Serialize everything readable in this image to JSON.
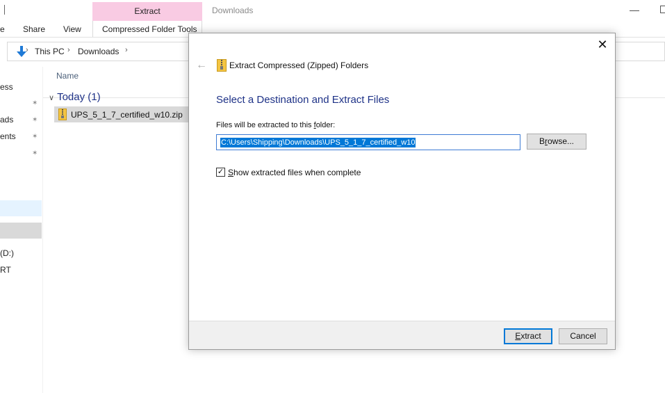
{
  "window": {
    "title": "Downloads",
    "minimize_glyph": "—"
  },
  "ribbon": {
    "context_tab_label": "Extract",
    "tabs": [
      "e",
      "Share",
      "View",
      "Compressed Folder Tools"
    ]
  },
  "address": {
    "crumbs": [
      "This PC",
      "Downloads"
    ],
    "separator": "›"
  },
  "nav_pane": {
    "items": [
      "ess",
      "ads",
      "ents",
      "(D:)",
      "RT"
    ],
    "pin_glyph": "✶"
  },
  "file_list": {
    "column_name": "Name",
    "group_label": "Today (1)",
    "group_chevron": "∨",
    "files": [
      {
        "name": "UPS_5_1_7_certified_w10.zip",
        "icon": "zip-folder-icon"
      }
    ]
  },
  "dialog": {
    "back_glyph": "←",
    "close_glyph": "✕",
    "title": "Extract Compressed (Zipped) Folders",
    "heading": "Select a Destination and Extract Files",
    "label_pre": "Files will be extracted to this ",
    "label_mnemonic": "f",
    "label_post": "older:",
    "path_value": "C:\\Users\\Shipping\\Downloads\\UPS_5_1_7_certified_w10",
    "browse_mnemonic": "r",
    "browse_pre": "B",
    "browse_post": "owse...",
    "checkbox_checked": true,
    "checkbox_mark": "✓",
    "checkbox_mnemonic": "S",
    "checkbox_label_rest": "how extracted files when complete",
    "extract_mnemonic": "E",
    "extract_rest": "xtract",
    "cancel_label": "Cancel"
  },
  "colors": {
    "accent": "#0078d7",
    "context_tab": "#f9cbe3",
    "heading": "#1e3287"
  }
}
